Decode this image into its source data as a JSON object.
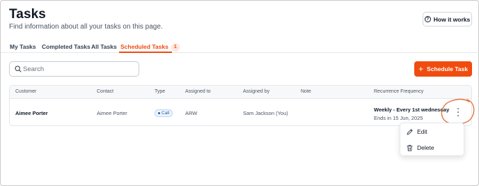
{
  "header": {
    "title": "Tasks",
    "subtitle": "Find information about all your tasks on this page.",
    "how_it_works_label": "How it works"
  },
  "tabs": [
    {
      "label": "My Tasks",
      "active": false
    },
    {
      "label": "Completed Tasks",
      "active": false
    },
    {
      "label": "All Tasks",
      "active": false
    },
    {
      "label": "Scheduled Tasks",
      "active": true,
      "badge": "1"
    }
  ],
  "search": {
    "placeholder": "Search",
    "value": ""
  },
  "schedule_button": {
    "label": "Schedule Task",
    "icon": "plus-icon"
  },
  "table": {
    "columns": [
      "Customer",
      "Contact",
      "Type",
      "Assigned to",
      "Assigned by",
      "Note",
      "Recurrence Frequency"
    ],
    "rows": [
      {
        "customer": "Aimee Porter",
        "contact": "Aimee Porter",
        "type": "Call",
        "assigned_to": "ARW",
        "assigned_by": "Sam Jackson (You)",
        "note": "",
        "recurrence": "Weekly - Every 1st wednesday",
        "ends": "Ends in 15 Jun, 2025"
      }
    ]
  },
  "row_menu": {
    "items": [
      {
        "label": "Edit",
        "icon": "pencil-icon"
      },
      {
        "label": "Delete",
        "icon": "trash-icon"
      }
    ]
  },
  "colors": {
    "accent": "#f04c0f",
    "annotation_circle": "#e2753f",
    "type_pill": "#1f5fa8"
  }
}
